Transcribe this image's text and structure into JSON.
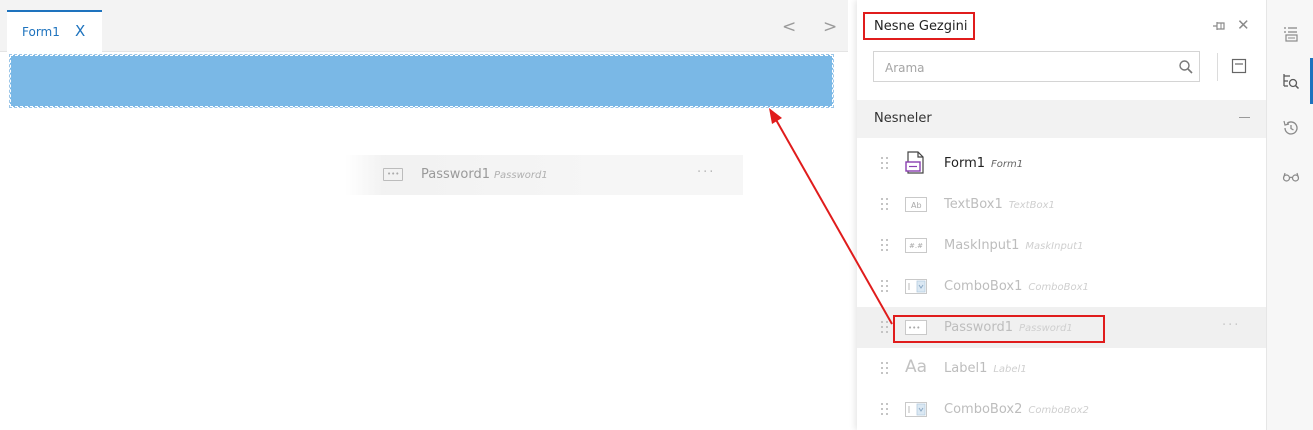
{
  "designer": {
    "tab": {
      "label": "Form1",
      "close": "X"
    },
    "nav": {
      "prev": "<",
      "next": ">"
    },
    "drag_preview": {
      "label": "Password1",
      "sublabel": "Password1",
      "more": "···"
    }
  },
  "panel": {
    "title": "Nesne Gezgini",
    "search_placeholder": "Arama",
    "section_title": "Nesneler",
    "items": [
      {
        "label": "Form1",
        "sublabel": "Form1",
        "icon": "form-icon"
      },
      {
        "label": "TextBox1",
        "sublabel": "TextBox1",
        "icon": "textbox-icon"
      },
      {
        "label": "MaskInput1",
        "sublabel": "MaskInput1",
        "icon": "maskinput-icon"
      },
      {
        "label": "ComboBox1",
        "sublabel": "ComboBox1",
        "icon": "combobox-icon"
      },
      {
        "label": "Password1",
        "sublabel": "Password1",
        "icon": "password-icon",
        "more": "···"
      },
      {
        "label": "Label1",
        "sublabel": "Label1",
        "icon": "label-icon",
        "icon_text": "Aa"
      },
      {
        "label": "ComboBox2",
        "sublabel": "ComboBox2",
        "icon": "combobox-icon"
      }
    ]
  },
  "icons": {
    "textbox_glyph": "Ab",
    "mask_glyph": "#.#",
    "password_glyph": "•••"
  },
  "colors": {
    "accent": "#1e73be",
    "annotation": "#e01c1c",
    "drop_zone": "#7ab8e6"
  }
}
